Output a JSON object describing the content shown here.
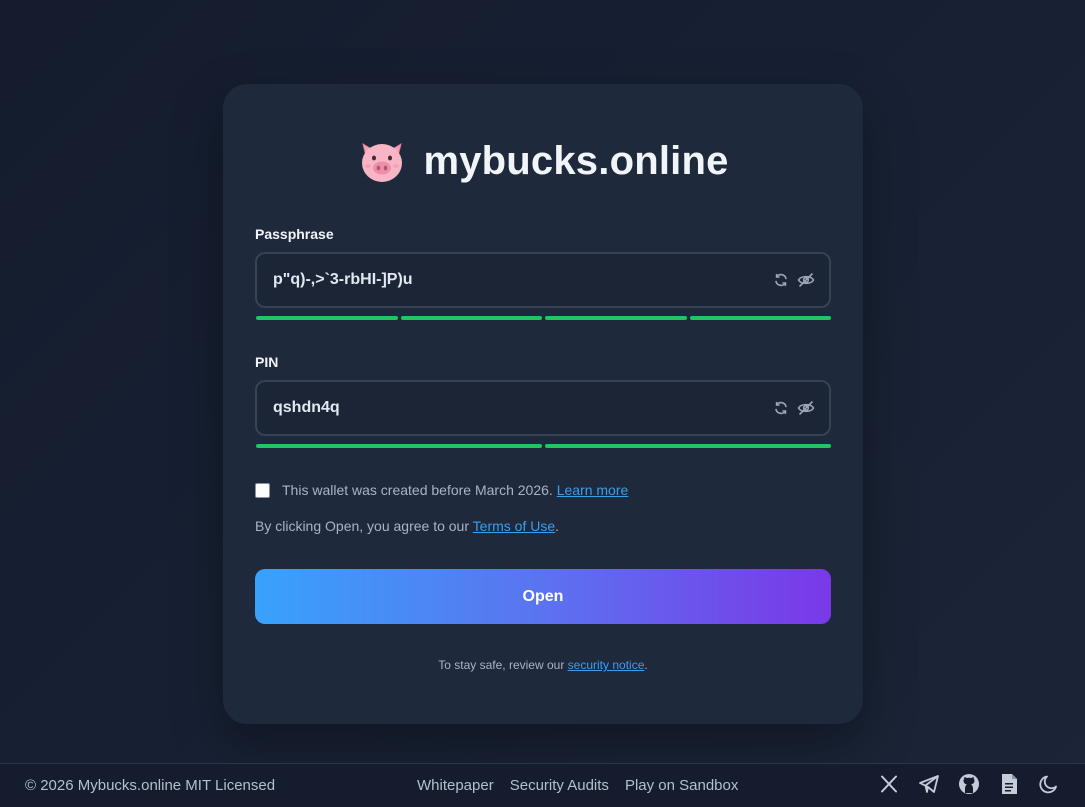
{
  "brand": {
    "name": "mybucks.online",
    "logo_icon": "pig-face-icon"
  },
  "passphrase": {
    "label": "Passphrase",
    "value": "p\"q)-,>`3-rbHI-]P)u",
    "strength_segments": 4,
    "strength_filled": 4,
    "strength_color": "#22c55e"
  },
  "pin": {
    "label": "PIN",
    "value": "qshdn4q",
    "strength_segments": 2,
    "strength_filled": 2,
    "strength_color": "#22c55e"
  },
  "legacy_wallet": {
    "checked": false,
    "text": "This wallet was created before March 2026.",
    "link": "Learn more"
  },
  "terms": {
    "prefix": "By clicking Open, you agree to our",
    "link": "Terms of Use",
    "suffix": "."
  },
  "open_button": {
    "label": "Open"
  },
  "safety": {
    "prefix": "To stay safe, review our",
    "link": "security notice",
    "suffix": "."
  },
  "footer": {
    "copyright": "© 2026 Mybucks.online MIT Licensed",
    "links": [
      "Whitepaper",
      "Security Audits",
      "Play on Sandbox"
    ],
    "social_icons": [
      "x-icon",
      "telegram-icon",
      "github-icon",
      "document-icon",
      "moon-icon"
    ]
  },
  "colors": {
    "accent_link": "#3b9ef0",
    "button_gradient_start": "#38a2fc",
    "button_gradient_end": "#7a38e8"
  }
}
